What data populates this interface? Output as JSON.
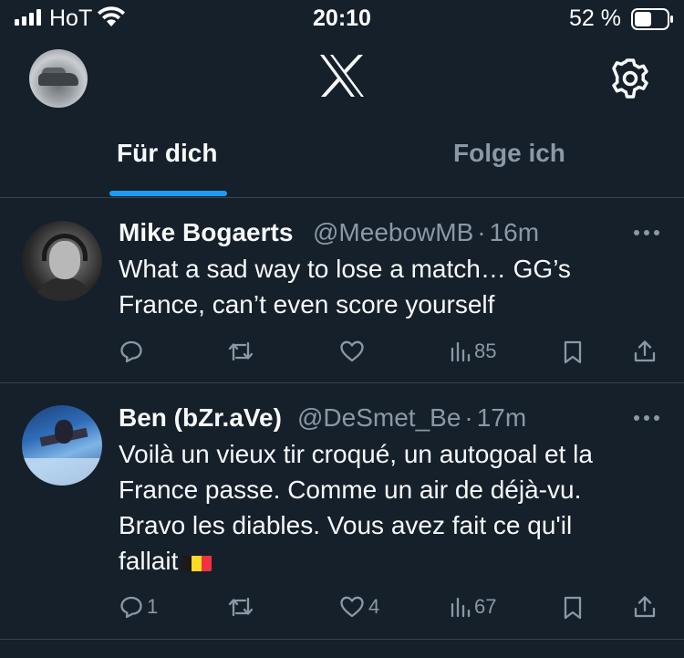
{
  "status_bar": {
    "carrier": "HoT",
    "time": "20:10",
    "battery_percent": "52 %",
    "battery_level": 0.52,
    "signal_bars": 4
  },
  "header": {
    "logo_icon": "x-logo-icon",
    "settings_icon": "gear-icon"
  },
  "tabs": [
    {
      "label": "Für dich",
      "active": true
    },
    {
      "label": "Folge ich",
      "active": false
    }
  ],
  "colors": {
    "background": "#15202b",
    "accent": "#1d9bf0",
    "muted": "#8b98a5",
    "divider": "#38444d"
  },
  "tweets": [
    {
      "name": "Mike Bogaerts",
      "handle": "@MeebowMB",
      "separator": "·",
      "time": "16m",
      "text_lines": [
        "What a sad way to lose a match… GG’s",
        "France, can’t even score yourself"
      ],
      "replies": "",
      "retweets": "",
      "likes": "",
      "views": "85"
    },
    {
      "name": "Ben (bZr.aVe)",
      "handle": "@DeSmet_Be",
      "separator": "·",
      "time": "17m",
      "text_lines": [
        "Voilà un vieux tir croqué, un autogoal et la",
        "France passe. Comme un air de déjà-vu.",
        "Bravo les diables. Vous avez fait ce qu'il",
        "fallait"
      ],
      "emoji": "belgian-flag-icon",
      "replies": "1",
      "retweets": "",
      "likes": "4",
      "views": "67"
    }
  ]
}
